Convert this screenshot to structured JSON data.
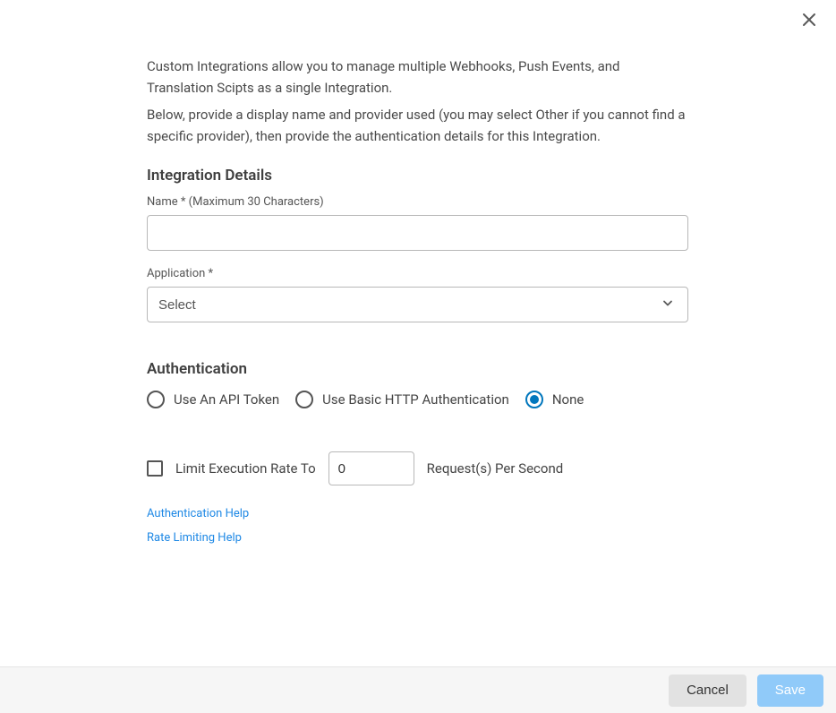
{
  "intro": {
    "para1": "Custom Integrations allow you to manage multiple Webhooks, Push Events, and Translation Scipts as a single Integration.",
    "para2": "Below, provide a display name and provider used (you may select Other if you cannot find a specific provider), then provide the authentication details for this Integration."
  },
  "details": {
    "title": "Integration Details",
    "name_label": "Name * (Maximum 30 Characters)",
    "name_value": "",
    "app_label": "Application *",
    "app_selected": "Select"
  },
  "auth": {
    "title": "Authentication",
    "options": {
      "api_token": "Use An API Token",
      "basic_http": "Use Basic HTTP Authentication",
      "none": "None"
    },
    "selected": "none"
  },
  "rate_limit": {
    "checkbox_checked": false,
    "label": "Limit Execution Rate To",
    "value": "0",
    "suffix": "Request(s) Per Second"
  },
  "help_links": {
    "auth": "Authentication Help",
    "rate": "Rate Limiting Help"
  },
  "footer": {
    "cancel": "Cancel",
    "save": "Save"
  }
}
